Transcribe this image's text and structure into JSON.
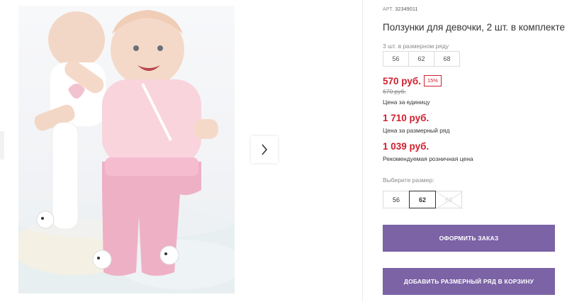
{
  "product": {
    "sku_label": "АРТ.",
    "sku": "32349011",
    "title": "Ползунки для девочки, 2 шт. в комплекте",
    "range_label": "3 шт. в размерном ряду",
    "range_sizes": [
      "56",
      "62",
      "68"
    ],
    "price": "570 руб.",
    "discount": "15%",
    "old_price": "670 руб.",
    "unit_price_caption": "Цена за единицу",
    "range_price": "1 710 руб.",
    "range_price_caption": "Цена за размерный ряд",
    "retail_price": "1 039 руб.",
    "retail_price_caption": "Рекомендуемая розничная цена"
  },
  "size_picker": {
    "label": "Выберите размер:",
    "options": [
      {
        "value": "56",
        "state": "available"
      },
      {
        "value": "62",
        "state": "selected"
      },
      {
        "value": "68",
        "state": "unavailable"
      }
    ]
  },
  "buttons": {
    "order": "ОФОРМИТЬ ЗАКАЗ",
    "add_range": "ДОБАВИТЬ РАЗМЕРНЫЙ РЯД В КОРЗИНУ"
  },
  "gallery": {
    "next_icon": "chevron-right-icon"
  },
  "colors": {
    "price_red": "#d0202f",
    "button_purple": "#7b63a6",
    "pants_pink": "#eeb0c4"
  }
}
